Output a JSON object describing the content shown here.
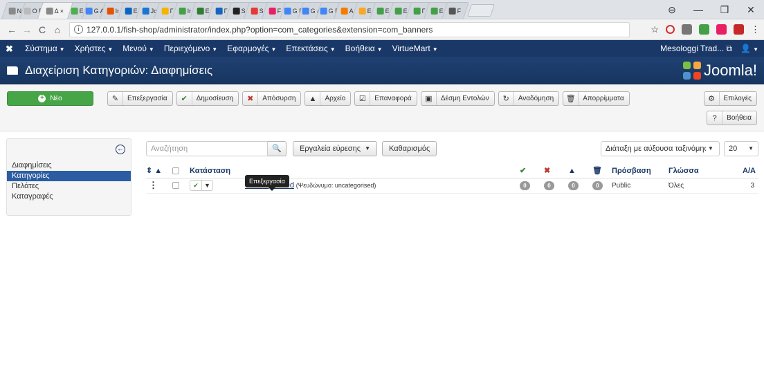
{
  "browser": {
    "tabs": [
      {
        "label": "N",
        "color": "#8a8a8a"
      },
      {
        "label": "Ο Γ",
        "color": "#bbb"
      },
      {
        "label": "Δ ×",
        "color": "#888"
      },
      {
        "label": "Ε",
        "color": "#4caf50"
      },
      {
        "label": "G A",
        "color": "#4285f4"
      },
      {
        "label": "Ir",
        "color": "#e65100"
      },
      {
        "label": "E",
        "color": "#0a66c2"
      },
      {
        "label": "Jc",
        "color": "#1976d2"
      },
      {
        "label": "Γ",
        "color": "#f4b400"
      },
      {
        "label": "Ir",
        "color": "#43a047"
      },
      {
        "label": "E",
        "color": "#2e7d32"
      },
      {
        "label": "Γ",
        "color": "#1565c0"
      },
      {
        "label": "S",
        "color": "#222"
      },
      {
        "label": "S",
        "color": "#e53935"
      },
      {
        "label": "F",
        "color": "#e91e63"
      },
      {
        "label": "G F",
        "color": "#4285f4"
      },
      {
        "label": "G a",
        "color": "#4285f4"
      },
      {
        "label": "G Γ",
        "color": "#4285f4"
      },
      {
        "label": "A",
        "color": "#f57c00"
      },
      {
        "label": "E",
        "color": "#f9a825"
      },
      {
        "label": "E",
        "color": "#43a047"
      },
      {
        "label": "E",
        "color": "#43a047"
      },
      {
        "label": "Γ",
        "color": "#43a047"
      },
      {
        "label": "E",
        "color": "#43a047"
      },
      {
        "label": "F",
        "color": "#555"
      }
    ],
    "url": "127.0.0.1/fish-shop/administrator/index.php?option=com_categories&extension=com_banners",
    "window_controls": [
      "⊖",
      "—",
      "❐",
      "✕"
    ]
  },
  "jnav": {
    "items": [
      "Σύστημα",
      "Χρήστες",
      "Μενού",
      "Περιεχόμενο",
      "Εφαρμογές",
      "Επεκτάσεις",
      "Βοήθεια",
      "VirtueMart"
    ],
    "site_name": "Mesologgi Trad...",
    "user_icon": "user-icon"
  },
  "header": {
    "title": "Διαχείριση Κατηγοριών: Διαφημίσεις",
    "brand": "Joomla!"
  },
  "toolbar": {
    "new_label": "Νέο",
    "buttons": [
      {
        "label": "Επεξεργασία",
        "icon": "edit-icon",
        "glyph": "✎",
        "color": "#333"
      },
      {
        "label": "Δημοσίευση",
        "icon": "check-icon",
        "glyph": "✔",
        "color": "#378137"
      },
      {
        "label": "Απόσυρση",
        "icon": "unpublish-icon",
        "glyph": "✖",
        "color": "#bd362f"
      },
      {
        "label": "Αρχείο",
        "icon": "archive-icon",
        "glyph": "▲",
        "color": "#333"
      },
      {
        "label": "Επαναφορά",
        "icon": "checkin-icon",
        "glyph": "☑",
        "color": "#333"
      },
      {
        "label": "Δέσμη Εντολών",
        "icon": "batch-icon",
        "glyph": "▣",
        "color": "#333"
      },
      {
        "label": "Αναδόμηση",
        "icon": "refresh-icon",
        "glyph": "↻",
        "color": "#333"
      },
      {
        "label": "Απορρίμματα",
        "icon": "trash-icon",
        "glyph": "🗑",
        "color": "#333"
      }
    ],
    "options_label": "Επιλογές",
    "help_label": "Βοήθεια"
  },
  "sidebar": {
    "items": [
      {
        "label": "Διαφημίσεις",
        "active": false
      },
      {
        "label": "Κατηγορίες",
        "active": true
      },
      {
        "label": "Πελάτες",
        "active": false
      },
      {
        "label": "Καταγραφές",
        "active": false
      }
    ]
  },
  "filters": {
    "search_placeholder": "Αναζήτηση",
    "search_tools": "Εργαλεία εύρεσης",
    "clear": "Καθαρισμός",
    "ordering": "Διάταξη με αύξουσα ταξινόμησr",
    "limit": "20"
  },
  "table": {
    "headers": {
      "status": "Κατάσταση",
      "access": "Πρόσβαση",
      "language": "Γλώσσα",
      "id": "Α/Α"
    },
    "tooltip": "Επεξεργασία",
    "rows": [
      {
        "title": "Uncategorised",
        "alias": "(Ψευδώνυμο: uncategorised)",
        "published": "0",
        "unpublished": "0",
        "archived": "0",
        "trashed": "0",
        "access": "Public",
        "language": "Όλες",
        "id": "3"
      }
    ]
  }
}
